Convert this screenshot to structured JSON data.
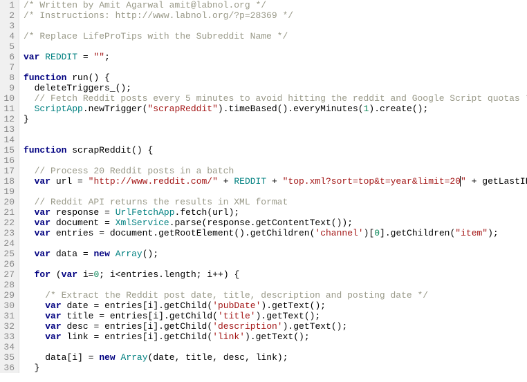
{
  "lines": [
    {
      "type": "comment",
      "text": "/* Written by Amit Agarwal amit@labnol.org */"
    },
    {
      "type": "comment",
      "text": "/* Instructions: http://www.labnol.org/?p=28369 */"
    },
    {
      "type": "blank",
      "text": ""
    },
    {
      "type": "comment",
      "text": "/* Replace LifeProTips with the Subreddit Name */"
    },
    {
      "type": "blank",
      "text": ""
    },
    {
      "type": "code",
      "indent": 0,
      "seg": [
        [
          "kw",
          "var"
        ],
        [
          "sp",
          " "
        ],
        [
          "glb",
          "REDDIT"
        ],
        [
          "sp",
          " "
        ],
        [
          "op",
          "="
        ],
        [
          "sp",
          " "
        ],
        [
          "str",
          "\"\""
        ],
        [
          "op",
          ";"
        ]
      ]
    },
    {
      "type": "blank",
      "text": ""
    },
    {
      "type": "code",
      "indent": 0,
      "seg": [
        [
          "kw",
          "function"
        ],
        [
          "sp",
          " "
        ],
        [
          "fn",
          "run"
        ],
        [
          "par",
          "()"
        ],
        [
          "sp",
          " "
        ],
        [
          "par",
          "{"
        ]
      ]
    },
    {
      "type": "code",
      "indent": 2,
      "seg": [
        [
          "fn",
          "deleteTriggers_"
        ],
        [
          "par",
          "();"
        ]
      ]
    },
    {
      "type": "codec",
      "indent": 2,
      "seg": [
        [
          "cmt",
          "// Fetch Reddit posts every 5 minutes to avoid hitting the reddit and Google Script quotas */"
        ]
      ]
    },
    {
      "type": "code",
      "indent": 2,
      "seg": [
        [
          "glb",
          "ScriptApp"
        ],
        [
          "op",
          "."
        ],
        [
          "fn",
          "newTrigger"
        ],
        [
          "par",
          "("
        ],
        [
          "str",
          "\"scrapReddit\""
        ],
        [
          "par",
          ")"
        ],
        [
          "op",
          "."
        ],
        [
          "fn",
          "timeBased"
        ],
        [
          "par",
          "()"
        ],
        [
          "op",
          "."
        ],
        [
          "fn",
          "everyMinutes"
        ],
        [
          "par",
          "("
        ],
        [
          "num",
          "1"
        ],
        [
          "par",
          ")"
        ],
        [
          "op",
          "."
        ],
        [
          "fn",
          "create"
        ],
        [
          "par",
          "();"
        ]
      ]
    },
    {
      "type": "code",
      "indent": 0,
      "seg": [
        [
          "par",
          "}"
        ]
      ]
    },
    {
      "type": "blank",
      "text": ""
    },
    {
      "type": "blank",
      "text": ""
    },
    {
      "type": "code",
      "indent": 0,
      "seg": [
        [
          "kw",
          "function"
        ],
        [
          "sp",
          " "
        ],
        [
          "fn",
          "scrapReddit"
        ],
        [
          "par",
          "()"
        ],
        [
          "sp",
          " "
        ],
        [
          "par",
          "{"
        ]
      ]
    },
    {
      "type": "blank",
      "text": ""
    },
    {
      "type": "codec",
      "indent": 2,
      "seg": [
        [
          "cmt",
          "// Process 20 Reddit posts in a batch"
        ]
      ]
    },
    {
      "type": "code",
      "indent": 2,
      "seg": [
        [
          "kw",
          "var"
        ],
        [
          "sp",
          " "
        ],
        [
          "id",
          "url"
        ],
        [
          "sp",
          " "
        ],
        [
          "op",
          "="
        ],
        [
          "sp",
          " "
        ],
        [
          "str",
          "\"http://www.reddit.com/\""
        ],
        [
          "sp",
          " "
        ],
        [
          "op",
          "+"
        ],
        [
          "sp",
          " "
        ],
        [
          "glb",
          "REDDIT"
        ],
        [
          "sp",
          " "
        ],
        [
          "op",
          "+"
        ],
        [
          "sp",
          " "
        ],
        [
          "str",
          "\"top.xml?sort=top&t=year&limit=20"
        ],
        [
          "cur",
          ""
        ],
        [
          "str",
          "\""
        ],
        [
          "sp",
          " "
        ],
        [
          "op",
          "+"
        ],
        [
          "sp",
          " "
        ],
        [
          "fn",
          "getLastID_"
        ],
        [
          "par",
          "();"
        ]
      ]
    },
    {
      "type": "blank",
      "text": ""
    },
    {
      "type": "codec",
      "indent": 2,
      "seg": [
        [
          "cmt",
          "// Reddit API returns the results in XML format"
        ]
      ]
    },
    {
      "type": "code",
      "indent": 2,
      "seg": [
        [
          "kw",
          "var"
        ],
        [
          "sp",
          " "
        ],
        [
          "id",
          "response"
        ],
        [
          "sp",
          " "
        ],
        [
          "op",
          "="
        ],
        [
          "sp",
          " "
        ],
        [
          "glb",
          "UrlFetchApp"
        ],
        [
          "op",
          "."
        ],
        [
          "fn",
          "fetch"
        ],
        [
          "par",
          "("
        ],
        [
          "id",
          "url"
        ],
        [
          "par",
          ");"
        ]
      ]
    },
    {
      "type": "code",
      "indent": 2,
      "seg": [
        [
          "kw",
          "var"
        ],
        [
          "sp",
          " "
        ],
        [
          "id",
          "document"
        ],
        [
          "sp",
          " "
        ],
        [
          "op",
          "="
        ],
        [
          "sp",
          " "
        ],
        [
          "glb",
          "XmlService"
        ],
        [
          "op",
          "."
        ],
        [
          "fn",
          "parse"
        ],
        [
          "par",
          "("
        ],
        [
          "id",
          "response"
        ],
        [
          "op",
          "."
        ],
        [
          "fn",
          "getContentText"
        ],
        [
          "par",
          "());"
        ]
      ]
    },
    {
      "type": "code",
      "indent": 2,
      "seg": [
        [
          "kw",
          "var"
        ],
        [
          "sp",
          " "
        ],
        [
          "id",
          "entries"
        ],
        [
          "sp",
          " "
        ],
        [
          "op",
          "="
        ],
        [
          "sp",
          " "
        ],
        [
          "id",
          "document"
        ],
        [
          "op",
          "."
        ],
        [
          "fn",
          "getRootElement"
        ],
        [
          "par",
          "()"
        ],
        [
          "op",
          "."
        ],
        [
          "fn",
          "getChildren"
        ],
        [
          "par",
          "("
        ],
        [
          "str",
          "'channel'"
        ],
        [
          "par",
          ")["
        ],
        [
          "num",
          "0"
        ],
        [
          "par",
          "]"
        ],
        [
          "op",
          "."
        ],
        [
          "fn",
          "getChildren"
        ],
        [
          "par",
          "("
        ],
        [
          "str",
          "\"item\""
        ],
        [
          "par",
          ");"
        ]
      ]
    },
    {
      "type": "blank",
      "text": ""
    },
    {
      "type": "code",
      "indent": 2,
      "seg": [
        [
          "kw",
          "var"
        ],
        [
          "sp",
          " "
        ],
        [
          "id",
          "data"
        ],
        [
          "sp",
          " "
        ],
        [
          "op",
          "="
        ],
        [
          "sp",
          " "
        ],
        [
          "kw",
          "new"
        ],
        [
          "sp",
          " "
        ],
        [
          "glb",
          "Array"
        ],
        [
          "par",
          "();"
        ]
      ]
    },
    {
      "type": "blank",
      "text": ""
    },
    {
      "type": "code",
      "indent": 2,
      "seg": [
        [
          "kw",
          "for"
        ],
        [
          "sp",
          " "
        ],
        [
          "par",
          "("
        ],
        [
          "kw",
          "var"
        ],
        [
          "sp",
          " "
        ],
        [
          "id",
          "i"
        ],
        [
          "op",
          "="
        ],
        [
          "num",
          "0"
        ],
        [
          "op",
          ";"
        ],
        [
          "sp",
          " "
        ],
        [
          "id",
          "i"
        ],
        [
          "op",
          "<"
        ],
        [
          "id",
          "entries"
        ],
        [
          "op",
          "."
        ],
        [
          "id",
          "length"
        ],
        [
          "op",
          ";"
        ],
        [
          "sp",
          " "
        ],
        [
          "id",
          "i"
        ],
        [
          "op",
          "++"
        ],
        [
          "par",
          ")"
        ],
        [
          "sp",
          " "
        ],
        [
          "par",
          "{"
        ]
      ]
    },
    {
      "type": "blank",
      "text": ""
    },
    {
      "type": "codec",
      "indent": 4,
      "seg": [
        [
          "cmt",
          "/* Extract the Reddit post date, title, description and posting date */"
        ]
      ]
    },
    {
      "type": "code",
      "indent": 4,
      "seg": [
        [
          "kw",
          "var"
        ],
        [
          "sp",
          " "
        ],
        [
          "id",
          "date"
        ],
        [
          "sp",
          " "
        ],
        [
          "op",
          "="
        ],
        [
          "sp",
          " "
        ],
        [
          "id",
          "entries"
        ],
        [
          "par",
          "["
        ],
        [
          "id",
          "i"
        ],
        [
          "par",
          "]"
        ],
        [
          "op",
          "."
        ],
        [
          "fn",
          "getChild"
        ],
        [
          "par",
          "("
        ],
        [
          "str",
          "'pubDate'"
        ],
        [
          "par",
          ")"
        ],
        [
          "op",
          "."
        ],
        [
          "fn",
          "getText"
        ],
        [
          "par",
          "();"
        ]
      ]
    },
    {
      "type": "code",
      "indent": 4,
      "seg": [
        [
          "kw",
          "var"
        ],
        [
          "sp",
          " "
        ],
        [
          "id",
          "title"
        ],
        [
          "sp",
          " "
        ],
        [
          "op",
          "="
        ],
        [
          "sp",
          " "
        ],
        [
          "id",
          "entries"
        ],
        [
          "par",
          "["
        ],
        [
          "id",
          "i"
        ],
        [
          "par",
          "]"
        ],
        [
          "op",
          "."
        ],
        [
          "fn",
          "getChild"
        ],
        [
          "par",
          "("
        ],
        [
          "str",
          "'title'"
        ],
        [
          "par",
          ")"
        ],
        [
          "op",
          "."
        ],
        [
          "fn",
          "getText"
        ],
        [
          "par",
          "();"
        ]
      ]
    },
    {
      "type": "code",
      "indent": 4,
      "seg": [
        [
          "kw",
          "var"
        ],
        [
          "sp",
          " "
        ],
        [
          "id",
          "desc"
        ],
        [
          "sp",
          " "
        ],
        [
          "op",
          "="
        ],
        [
          "sp",
          " "
        ],
        [
          "id",
          "entries"
        ],
        [
          "par",
          "["
        ],
        [
          "id",
          "i"
        ],
        [
          "par",
          "]"
        ],
        [
          "op",
          "."
        ],
        [
          "fn",
          "getChild"
        ],
        [
          "par",
          "("
        ],
        [
          "str",
          "'description'"
        ],
        [
          "par",
          ")"
        ],
        [
          "op",
          "."
        ],
        [
          "fn",
          "getText"
        ],
        [
          "par",
          "();"
        ]
      ]
    },
    {
      "type": "code",
      "indent": 4,
      "seg": [
        [
          "kw",
          "var"
        ],
        [
          "sp",
          " "
        ],
        [
          "id",
          "link"
        ],
        [
          "sp",
          " "
        ],
        [
          "op",
          "="
        ],
        [
          "sp",
          " "
        ],
        [
          "id",
          "entries"
        ],
        [
          "par",
          "["
        ],
        [
          "id",
          "i"
        ],
        [
          "par",
          "]"
        ],
        [
          "op",
          "."
        ],
        [
          "fn",
          "getChild"
        ],
        [
          "par",
          "("
        ],
        [
          "str",
          "'link'"
        ],
        [
          "par",
          ")"
        ],
        [
          "op",
          "."
        ],
        [
          "fn",
          "getText"
        ],
        [
          "par",
          "();"
        ]
      ]
    },
    {
      "type": "blank",
      "text": ""
    },
    {
      "type": "code",
      "indent": 4,
      "seg": [
        [
          "id",
          "data"
        ],
        [
          "par",
          "["
        ],
        [
          "id",
          "i"
        ],
        [
          "par",
          "]"
        ],
        [
          "sp",
          " "
        ],
        [
          "op",
          "="
        ],
        [
          "sp",
          " "
        ],
        [
          "kw",
          "new"
        ],
        [
          "sp",
          " "
        ],
        [
          "glb",
          "Array"
        ],
        [
          "par",
          "("
        ],
        [
          "id",
          "date"
        ],
        [
          "op",
          ","
        ],
        [
          "sp",
          " "
        ],
        [
          "id",
          "title"
        ],
        [
          "op",
          ","
        ],
        [
          "sp",
          " "
        ],
        [
          "id",
          "desc"
        ],
        [
          "op",
          ","
        ],
        [
          "sp",
          " "
        ],
        [
          "id",
          "link"
        ],
        [
          "par",
          ");"
        ]
      ]
    },
    {
      "type": "code",
      "indent": 2,
      "seg": [
        [
          "par",
          "}"
        ]
      ]
    }
  ]
}
